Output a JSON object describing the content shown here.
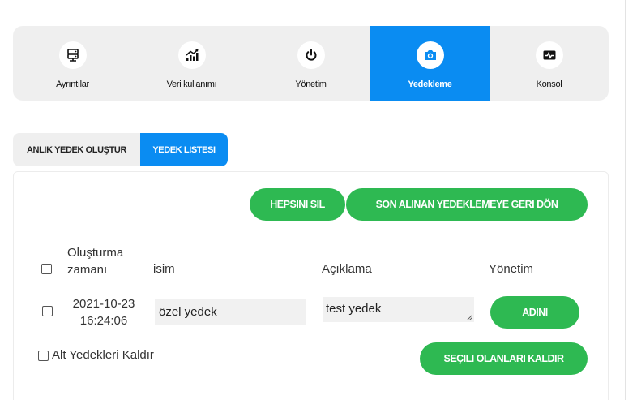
{
  "top_tabs": [
    {
      "label": "Ayrıntılar",
      "icon": "server-icon"
    },
    {
      "label": "Veri kullanımı",
      "icon": "chart-icon"
    },
    {
      "label": "Yönetim",
      "icon": "power-icon"
    },
    {
      "label": "Yedekleme",
      "icon": "camera-icon",
      "active": true
    },
    {
      "label": "Konsol",
      "icon": "console-icon"
    }
  ],
  "sub_tabs": [
    {
      "label": "ANLIK YEDEK OLUŞTUR"
    },
    {
      "label": "YEDEK LISTESI",
      "active": true
    }
  ],
  "actions": {
    "delete_all": "HEPSINI SIL",
    "revert_last": "SON ALINAN YEDEKLEMEYE GERI DÖN",
    "remove_selected": "SEÇILI OLANLARI KALDIR"
  },
  "table": {
    "headers": {
      "created": "Oluşturma zamanı",
      "name": "isim",
      "description": "Açıklama",
      "management": "Yönetim"
    },
    "rows": [
      {
        "date": "2021-10-23",
        "time": "16:24:06",
        "name": "özel yedek",
        "description": "test yedek",
        "action": "ADINI"
      }
    ]
  },
  "remove_sub_backups_label": "Alt Yedekleri Kaldır",
  "colors": {
    "accent_blue": "#0a8cf2",
    "green": "#2eb952",
    "tab_bg": "#efefef"
  }
}
